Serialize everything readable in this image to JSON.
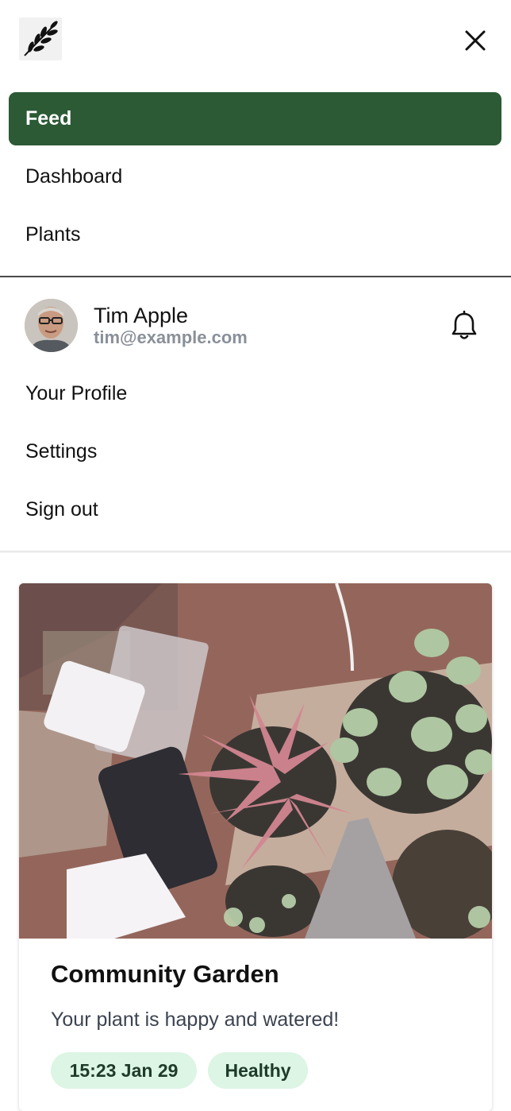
{
  "header": {
    "logo_icon": "leaf-sprig-icon",
    "close_icon": "close-icon"
  },
  "nav": {
    "items": [
      {
        "label": "Feed",
        "active": true
      },
      {
        "label": "Dashboard",
        "active": false
      },
      {
        "label": "Plants",
        "active": false
      }
    ]
  },
  "user": {
    "name": "Tim Apple",
    "email": "tim@example.com",
    "notifications_icon": "bell-icon"
  },
  "user_menu": {
    "items": [
      {
        "label": "Your Profile"
      },
      {
        "label": "Settings"
      },
      {
        "label": "Sign out"
      }
    ]
  },
  "feed": {
    "cards": [
      {
        "title": "Community Garden",
        "message": "Your plant is happy and watered!",
        "timestamp": "15:23 Jan 29",
        "status": "Healthy"
      }
    ]
  },
  "colors": {
    "accent": "#2b5a35",
    "badge_bg": "#dcf5e4",
    "muted_text": "#8a9099"
  }
}
